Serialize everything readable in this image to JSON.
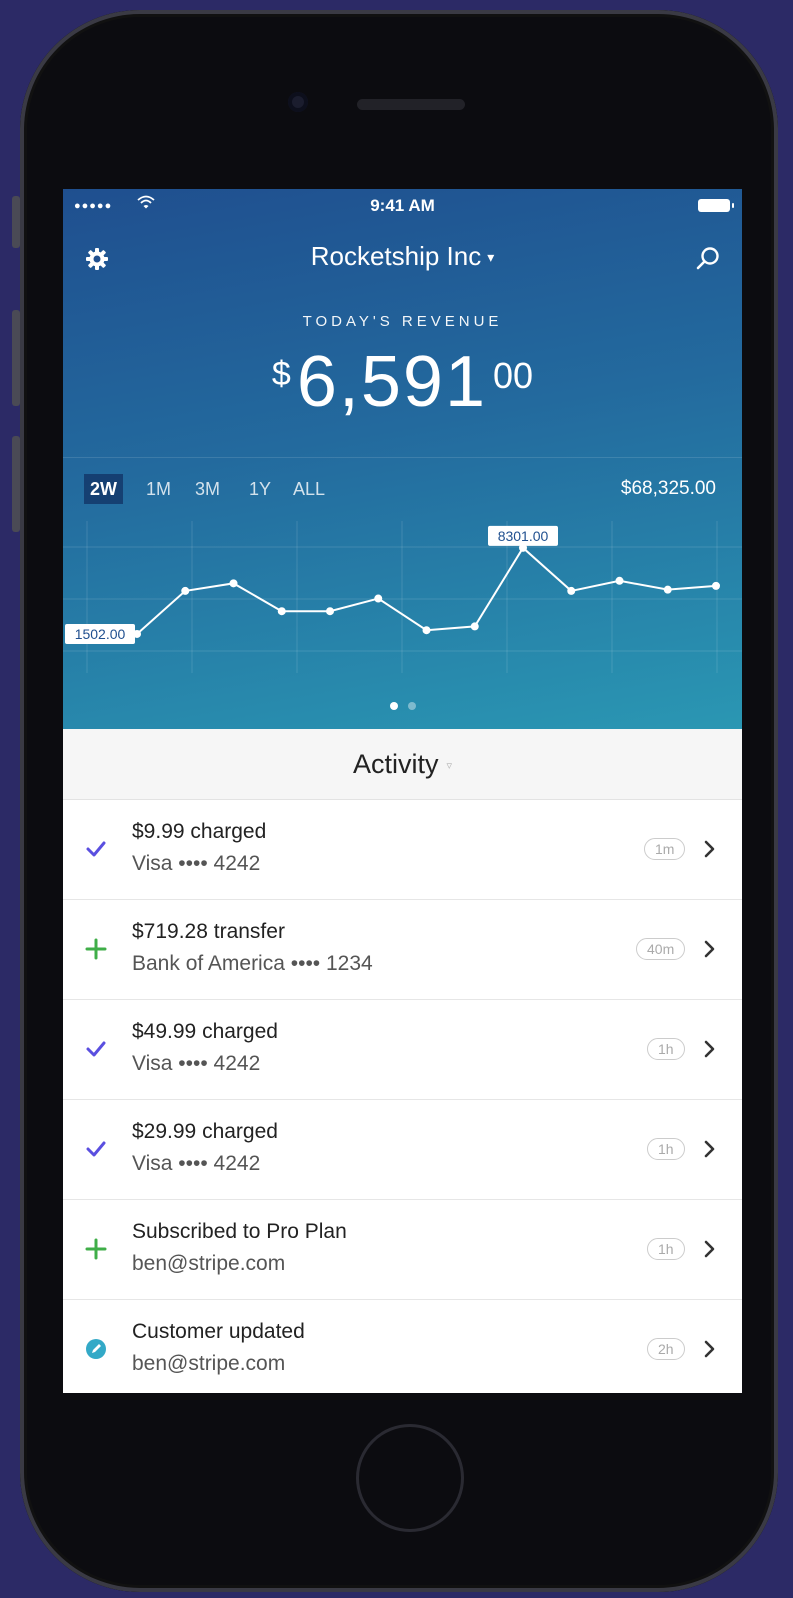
{
  "status_bar": {
    "time": "9:41 AM",
    "signal": "●●●●●"
  },
  "header": {
    "company": "Rocketship Inc",
    "caret": "▾",
    "revenue_label": "TODAY'S REVENUE",
    "revenue_currency": "$",
    "revenue_main": "6,591",
    "revenue_cents": "00"
  },
  "ranges": [
    {
      "label": "2W",
      "active": true
    },
    {
      "label": "1M",
      "active": false
    },
    {
      "label": "3M",
      "active": false
    },
    {
      "label": "1Y",
      "active": false
    },
    {
      "label": "ALL",
      "active": false
    }
  ],
  "range_total": "$68,325.00",
  "chart_data": {
    "type": "line",
    "values": [
      1502,
      4900,
      5500,
      3300,
      3300,
      4300,
      1800,
      2100,
      8301,
      4900,
      5700,
      5000,
      5300
    ],
    "callouts": [
      {
        "index": 0,
        "label": "1502.00"
      },
      {
        "index": 8,
        "label": "8301.00"
      }
    ],
    "ylim": [
      0,
      9000
    ],
    "grid": true,
    "line_color": "#ffffff"
  },
  "pager": {
    "count": 2,
    "active": 0
  },
  "activity": {
    "title": "Activity",
    "caret": "▿"
  },
  "feed": [
    {
      "icon": "check",
      "title": "$9.99 charged",
      "subtitle": "Visa •••• 4242",
      "time": "1m"
    },
    {
      "icon": "plus",
      "title": "$719.28 transfer",
      "subtitle": "Bank of America •••• 1234",
      "time": "40m"
    },
    {
      "icon": "check",
      "title": "$49.99 charged",
      "subtitle": "Visa •••• 4242",
      "time": "1h"
    },
    {
      "icon": "check",
      "title": "$29.99 charged",
      "subtitle": "Visa •••• 4242",
      "time": "1h"
    },
    {
      "icon": "plus",
      "title": "Subscribed to Pro Plan",
      "subtitle": "ben@stripe.com",
      "time": "1h"
    },
    {
      "icon": "edit",
      "title": "Customer updated",
      "subtitle": "ben@stripe.com",
      "time": "2h"
    }
  ],
  "colors": {
    "check": "#5a4fe0",
    "plus": "#3fae48",
    "edit": "#33a9c7"
  }
}
